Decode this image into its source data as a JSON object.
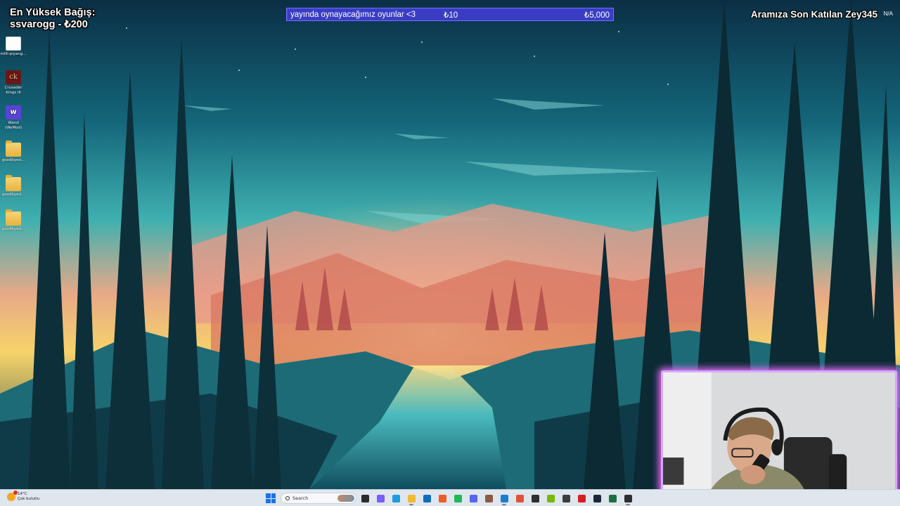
{
  "overlay": {
    "top_donor": {
      "heading": "En Yüksek Bağış:",
      "donor_line": "ssvarogg - ₺200"
    },
    "donation_goal": {
      "title": "yayında oynayacağımız oyunlar <3",
      "current": "₺10",
      "target": "₺5,000",
      "progress_fraction": 0.002
    },
    "latest_member": {
      "text": "Aramıza Son Katılan Zey345",
      "suffix": "N/A"
    }
  },
  "desktop": {
    "icons": [
      {
        "label": "milli-piyang...",
        "icon": "milli-piyango-app-icon"
      },
      {
        "label": "Crusader Kings III",
        "icon": "crusader-kings-icon"
      },
      {
        "label": "Wand (WeMod)",
        "icon": "wand-icon"
      },
      {
        "label": "goodbyed...",
        "icon": "folder-icon"
      },
      {
        "label": "goodbyed...",
        "icon": "folder-icon"
      },
      {
        "label": "goodbyed...",
        "icon": "folder-icon"
      }
    ]
  },
  "taskbar": {
    "weather": {
      "temperature": "14°C",
      "condition": "Çok bulutlu",
      "icon": "weather-cloud-icon"
    },
    "search_placeholder": "Search",
    "apps": [
      {
        "name": "task-view-icon",
        "color": "#2b2b2b"
      },
      {
        "name": "copilot-icon",
        "color": "#7b5cff"
      },
      {
        "name": "edge-icon",
        "color": "#1f9bde"
      },
      {
        "name": "file-explorer-icon",
        "color": "#f2b92e"
      },
      {
        "name": "outlook-icon",
        "color": "#0f6cbd"
      },
      {
        "name": "brave-icon",
        "color": "#f05a24"
      },
      {
        "name": "spotify-icon",
        "color": "#1db954"
      },
      {
        "name": "discord-icon",
        "color": "#5865f2"
      },
      {
        "name": "chat-app-icon",
        "color": "#8a5a44"
      },
      {
        "name": "vscode-icon",
        "color": "#1b7fd1"
      },
      {
        "name": "streaming-app-icon",
        "color": "#e0533b"
      },
      {
        "name": "terminal-icon",
        "color": "#2f2f2f"
      },
      {
        "name": "nvidia-icon",
        "color": "#76b900"
      },
      {
        "name": "media-player-icon",
        "color": "#3d3d3d"
      },
      {
        "name": "record-icon",
        "color": "#d32121"
      },
      {
        "name": "steam-icon",
        "color": "#1b2838"
      },
      {
        "name": "excel-icon",
        "color": "#1d7044"
      },
      {
        "name": "obs-icon",
        "color": "#302e31"
      }
    ]
  }
}
